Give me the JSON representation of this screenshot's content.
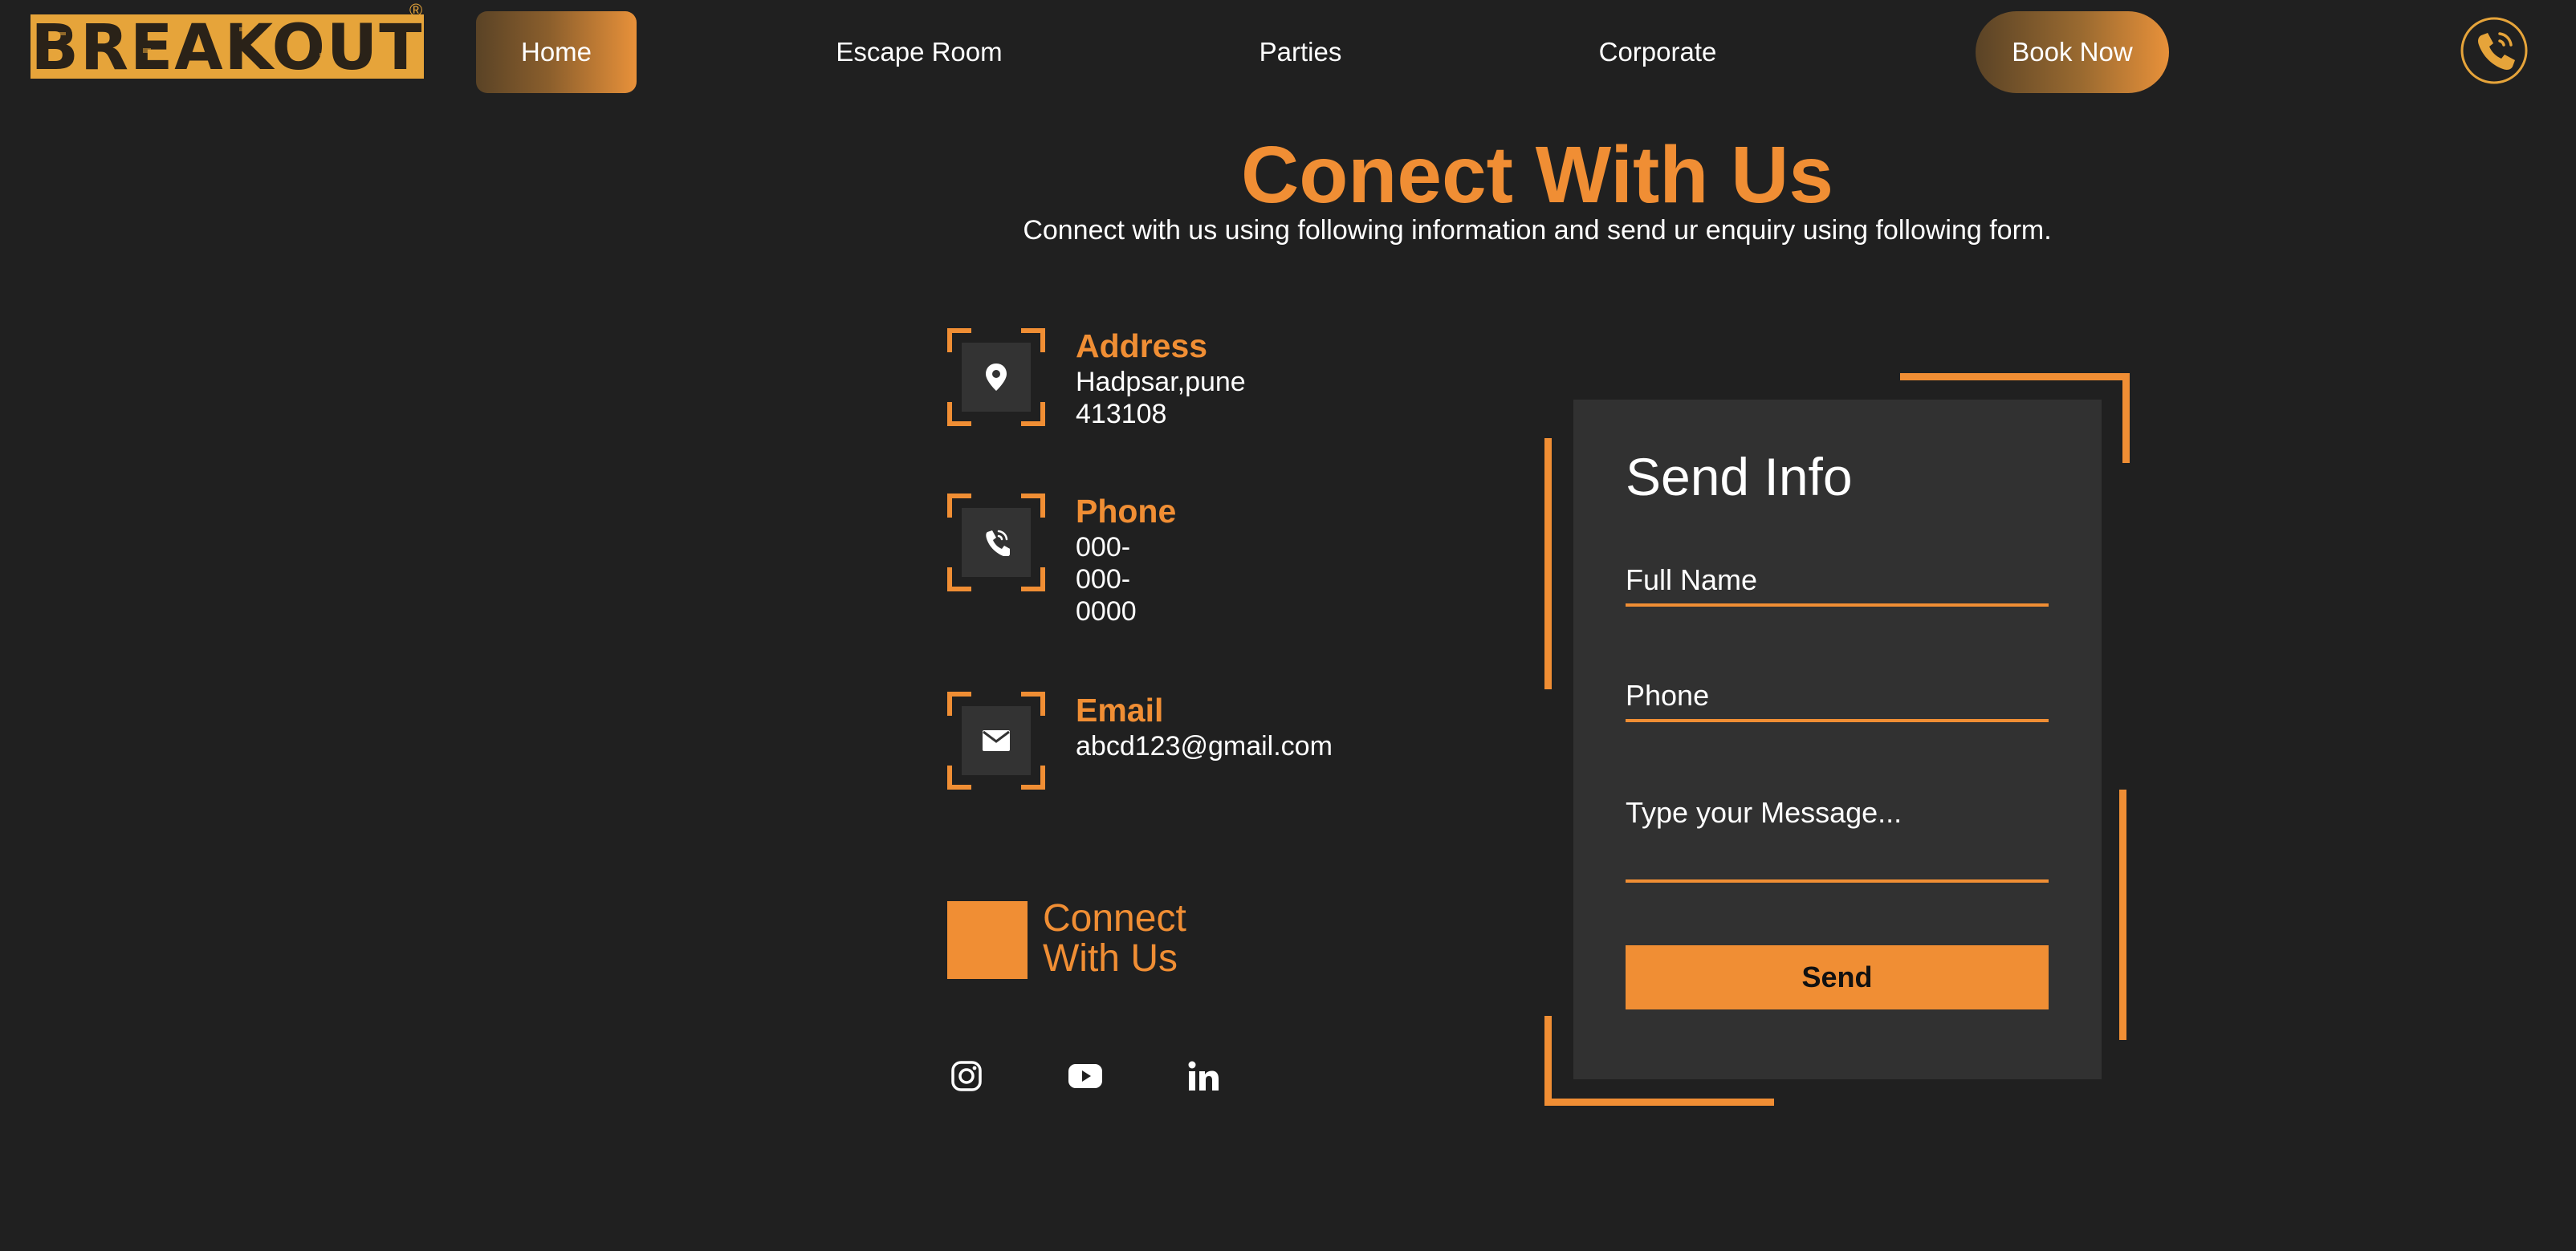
{
  "header": {
    "logo_text": "BREAKOUT",
    "logo_reg": "®",
    "nav": {
      "home": "Home",
      "escape_room": "Escape Room",
      "parties": "Parties",
      "corporate": "Corporate"
    },
    "book_now": "Book Now",
    "call_icon": "phone-call-icon"
  },
  "page": {
    "title": "Conect With Us",
    "subtitle": "Connect with us using following information and send ur enquiry using following form."
  },
  "contact": {
    "address": {
      "label": "Address",
      "value": "Hadpsar,pune\n413108",
      "icon": "location-pin-icon"
    },
    "phone": {
      "label": "Phone",
      "value": "000-\n000-\n0000",
      "icon": "phone-icon"
    },
    "email": {
      "label": "Email",
      "value": "abcd123@gmail.com",
      "icon": "envelope-icon"
    }
  },
  "connect": {
    "heading": "Connect With Us",
    "social": [
      "instagram-icon",
      "youtube-icon",
      "linkedin-icon"
    ]
  },
  "form": {
    "title": "Send Info",
    "full_name_placeholder": "Full Name",
    "phone_placeholder": "Phone",
    "message_placeholder": "Type your Message...",
    "send_label": "Send"
  },
  "colors": {
    "accent": "#f08e34",
    "background": "#202020",
    "card": "#313131",
    "logo": "#e6a43a"
  }
}
